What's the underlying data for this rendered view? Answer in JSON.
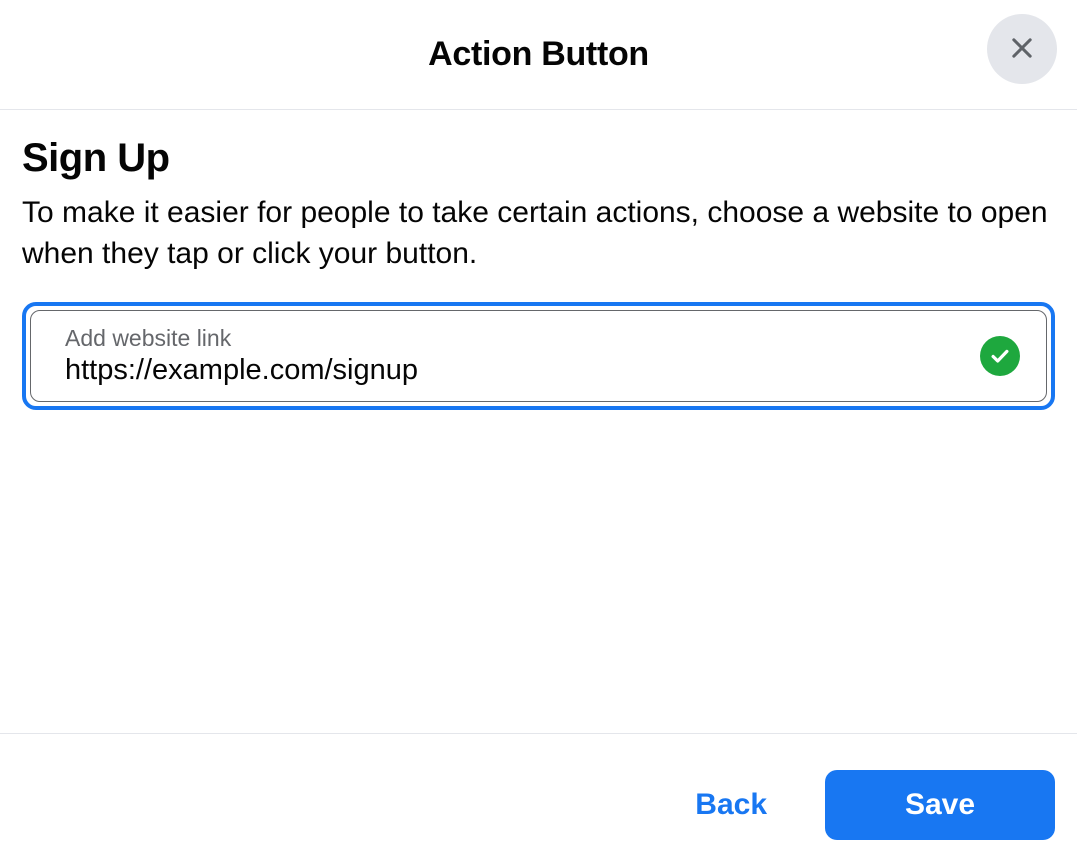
{
  "header": {
    "title": "Action Button"
  },
  "main": {
    "heading": "Sign Up",
    "description": "To make it easier for people to take certain actions, choose a website to open when they tap or click your button.",
    "field": {
      "label": "Add website link",
      "value": "https://example.com/signup"
    }
  },
  "footer": {
    "back_label": "Back",
    "save_label": "Save"
  }
}
